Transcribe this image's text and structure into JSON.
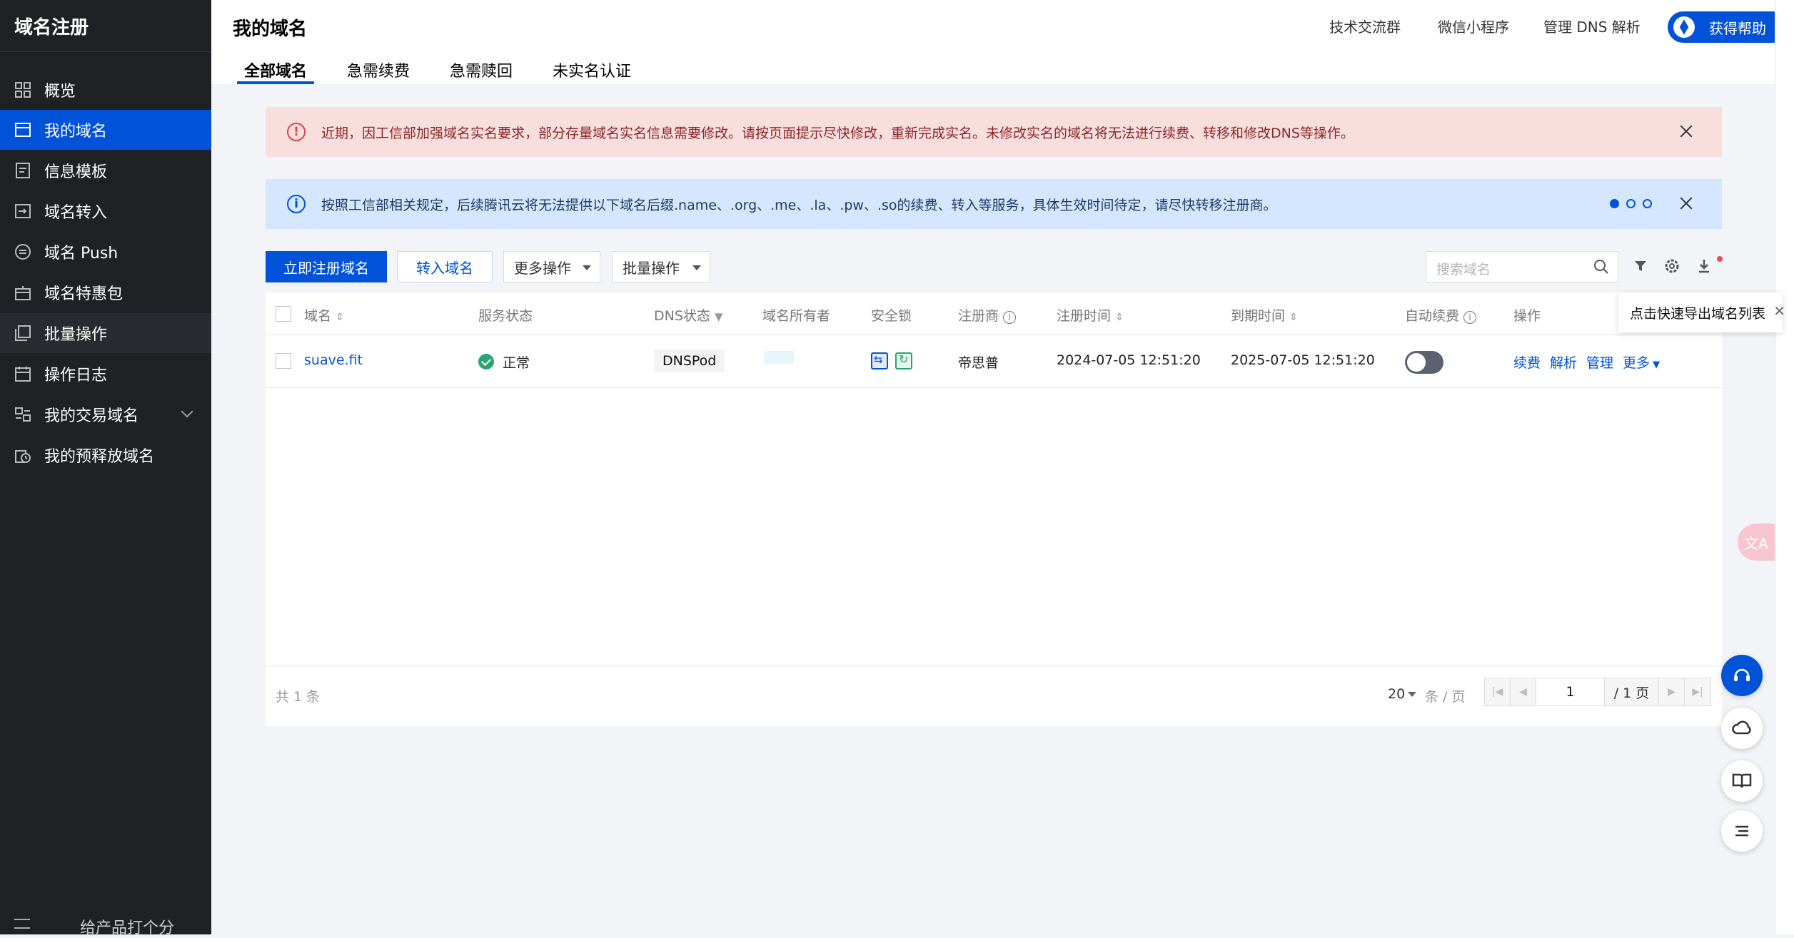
{
  "sidebar": {
    "title": "域名注册",
    "items": [
      {
        "label": "概览"
      },
      {
        "label": "我的域名"
      },
      {
        "label": "信息模板"
      },
      {
        "label": "域名转入"
      },
      {
        "label": "域名 Push"
      },
      {
        "label": "域名特惠包"
      },
      {
        "label": "批量操作"
      },
      {
        "label": "操作日志"
      },
      {
        "label": "我的交易域名"
      },
      {
        "label": "我的预释放域名"
      }
    ],
    "bottom_text": "给产品打个分"
  },
  "header": {
    "title": "我的域名",
    "links": [
      "技术交流群",
      "微信小程序",
      "管理 DNS 解析"
    ],
    "help_label": "获得帮助"
  },
  "tabs": [
    "全部域名",
    "急需续费",
    "急需赎回",
    "未实名认证"
  ],
  "alerts": {
    "red": "近期，因工信部加强域名实名要求，部分存量域名实名信息需要修改。请按页面提示尽快修改，重新完成实名。未修改实名的域名将无法进行续费、转移和修改DNS等操作。",
    "blue": "按照工信部相关规定，后续腾讯云将无法提供以下域名后缀.name、.org、.me、.la、.pw、.so的续费、转入等服务，具体生效时间待定，请尽快转移注册商。"
  },
  "toolbar": {
    "register_label": "立即注册域名",
    "transfer_label": "转入域名",
    "more_ops_label": "更多操作",
    "batch_ops_label": "批量操作",
    "search_placeholder": "搜索域名",
    "export_tooltip": "点击快速导出域名列表"
  },
  "table": {
    "columns": [
      "域名",
      "服务状态",
      "DNS状态",
      "域名所有者",
      "安全锁",
      "注册商",
      "注册时间",
      "到期时间",
      "自动续费",
      "操作"
    ],
    "rows": [
      {
        "domain": "suave.fit",
        "status": "正常",
        "dns": "DNSPod",
        "registrar": "帝思普",
        "reg_time": "2024-07-05 12:51:20",
        "exp_time": "2025-07-05 12:51:20",
        "auto_renew": false,
        "actions": [
          "续费",
          "解析",
          "管理",
          "更多"
        ]
      }
    ],
    "footer": {
      "total": "共 1 条",
      "page_size": "20",
      "page_unit": "条 / 页",
      "current_page": "1",
      "total_pages": "/ 1 页"
    }
  },
  "colors": {
    "primary": "#0052d9",
    "sidebar_bg": "#202124",
    "success": "#2ba471"
  }
}
